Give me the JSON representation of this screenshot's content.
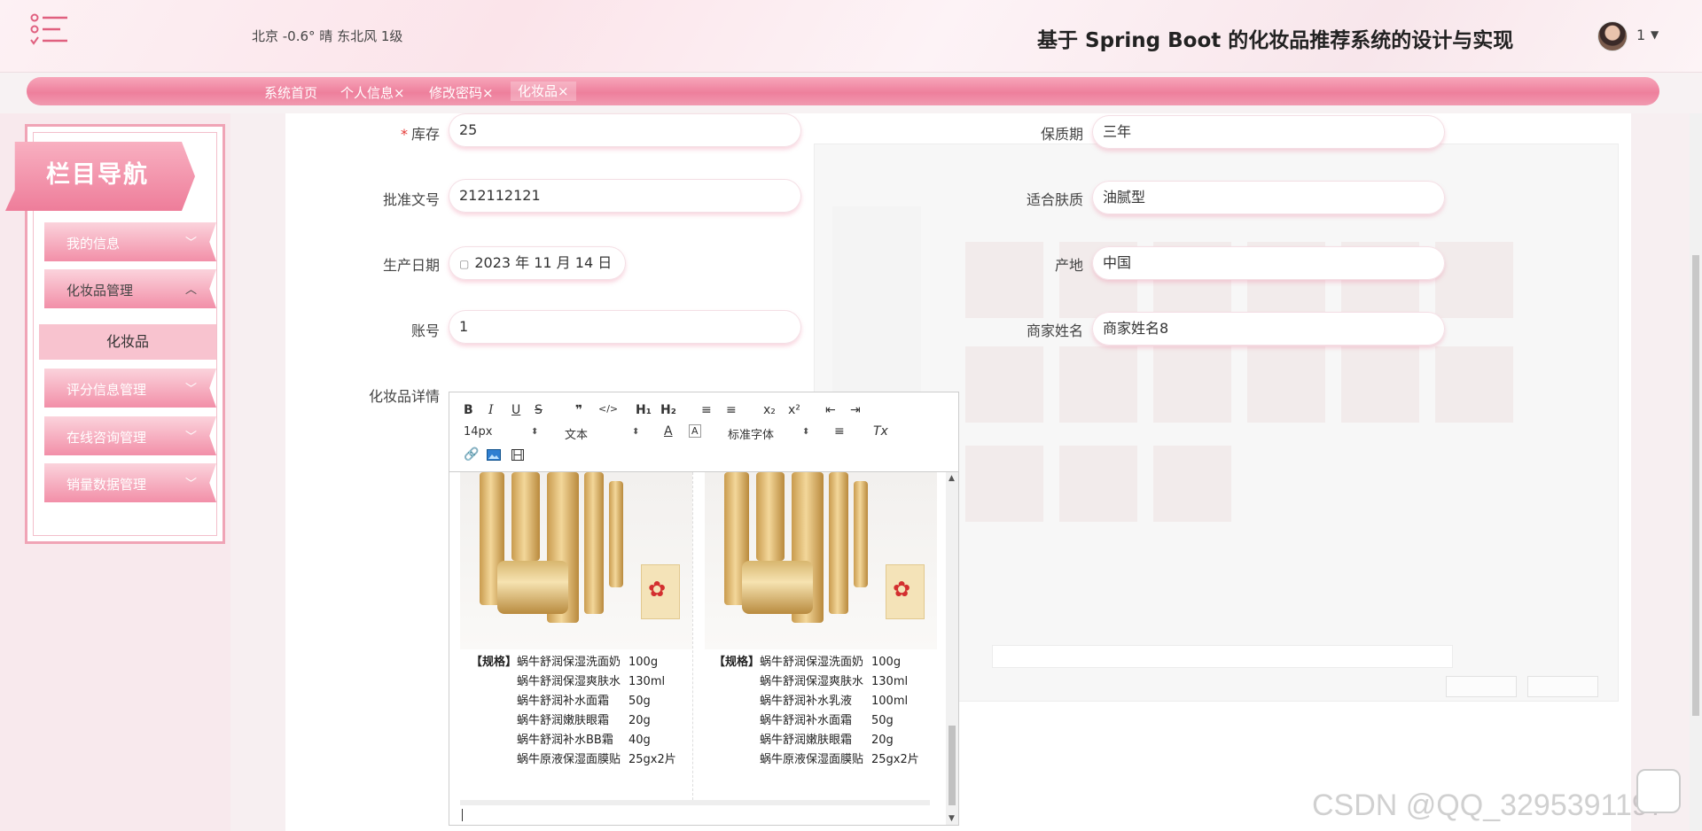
{
  "header": {
    "weather": "北京  -0.6°  晴  东北风  1级",
    "title": "基于 Spring Boot 的化妆品推荐系统的设计与实现",
    "user": "1"
  },
  "tabs": [
    {
      "label": "系统首页"
    },
    {
      "label": "个人信息×"
    },
    {
      "label": "修改密码×"
    },
    {
      "label": "化妆品×"
    }
  ],
  "sidebar": {
    "title": "栏目导航",
    "items": [
      {
        "label": "我的信息"
      },
      {
        "label": "化妆品管理"
      },
      {
        "label": "评分信息管理"
      },
      {
        "label": "在线咨询管理"
      },
      {
        "label": "销量数据管理"
      }
    ],
    "submenu": "化妆品"
  },
  "form": {
    "stock_label": "库存",
    "stock_value": "25",
    "approval_label": "批准文号",
    "approval_value": "212112121",
    "prod_date_label": "生产日期",
    "prod_date_value": "2023 年 11 月 14 日",
    "account_label": "账号",
    "account_value": "1",
    "detail_label": "化妆品详情",
    "shelf_label": "保质期",
    "shelf_value": "三年",
    "skin_label": "适合肤质",
    "skin_value": "油腻型",
    "origin_label": "产地",
    "origin_value": "中国",
    "merchant_label": "商家姓名",
    "merchant_value": "商家姓名8"
  },
  "editor": {
    "toolbar": {
      "bold": "B",
      "italic": "I",
      "underline": "U",
      "strike": "S",
      "quote": "❞",
      "code": "</>",
      "h1": "H₁",
      "h2": "H₂",
      "ol": "≡",
      "ul": "≡",
      "sub": "x₂",
      "sup": "x²",
      "outdent": "⇤",
      "indent": "⇥",
      "size": "14px",
      "text": "文本",
      "color": "A",
      "bg": "A",
      "font": "标准字体",
      "align": "≡",
      "clear": "Tx"
    },
    "spec_header": "【规格】",
    "specs_left": [
      {
        "name": "蜗牛舒润保湿洗面奶",
        "qty": "100g"
      },
      {
        "name": "蜗牛舒润保湿爽肤水",
        "qty": "130ml"
      },
      {
        "name": "蜗牛舒润补水面霜",
        "qty": "50g"
      },
      {
        "name": "蜗牛舒润嫩肤眼霜",
        "qty": "20g"
      },
      {
        "name": "蜗牛舒润补水BB霜",
        "qty": "40g"
      },
      {
        "name": "蜗牛原液保湿面膜贴",
        "qty": "25gx2片"
      }
    ],
    "specs_right": [
      {
        "name": "蜗牛舒润保湿洗面奶",
        "qty": "100g"
      },
      {
        "name": "蜗牛舒润保湿爽肤水",
        "qty": "130ml"
      },
      {
        "name": "蜗牛舒润补水乳液",
        "qty": "100ml"
      },
      {
        "name": "蜗牛舒润补水面霜",
        "qty": "50g"
      },
      {
        "name": "蜗牛舒润嫩肤眼霜",
        "qty": "20g"
      },
      {
        "name": "蜗牛原液保湿面膜贴",
        "qty": "25gx2片"
      }
    ]
  },
  "watermark": "CSDN @QQ_3295391197",
  "colors": {
    "accent": "#ee7f9c",
    "accent_light": "#f8c3cf"
  }
}
